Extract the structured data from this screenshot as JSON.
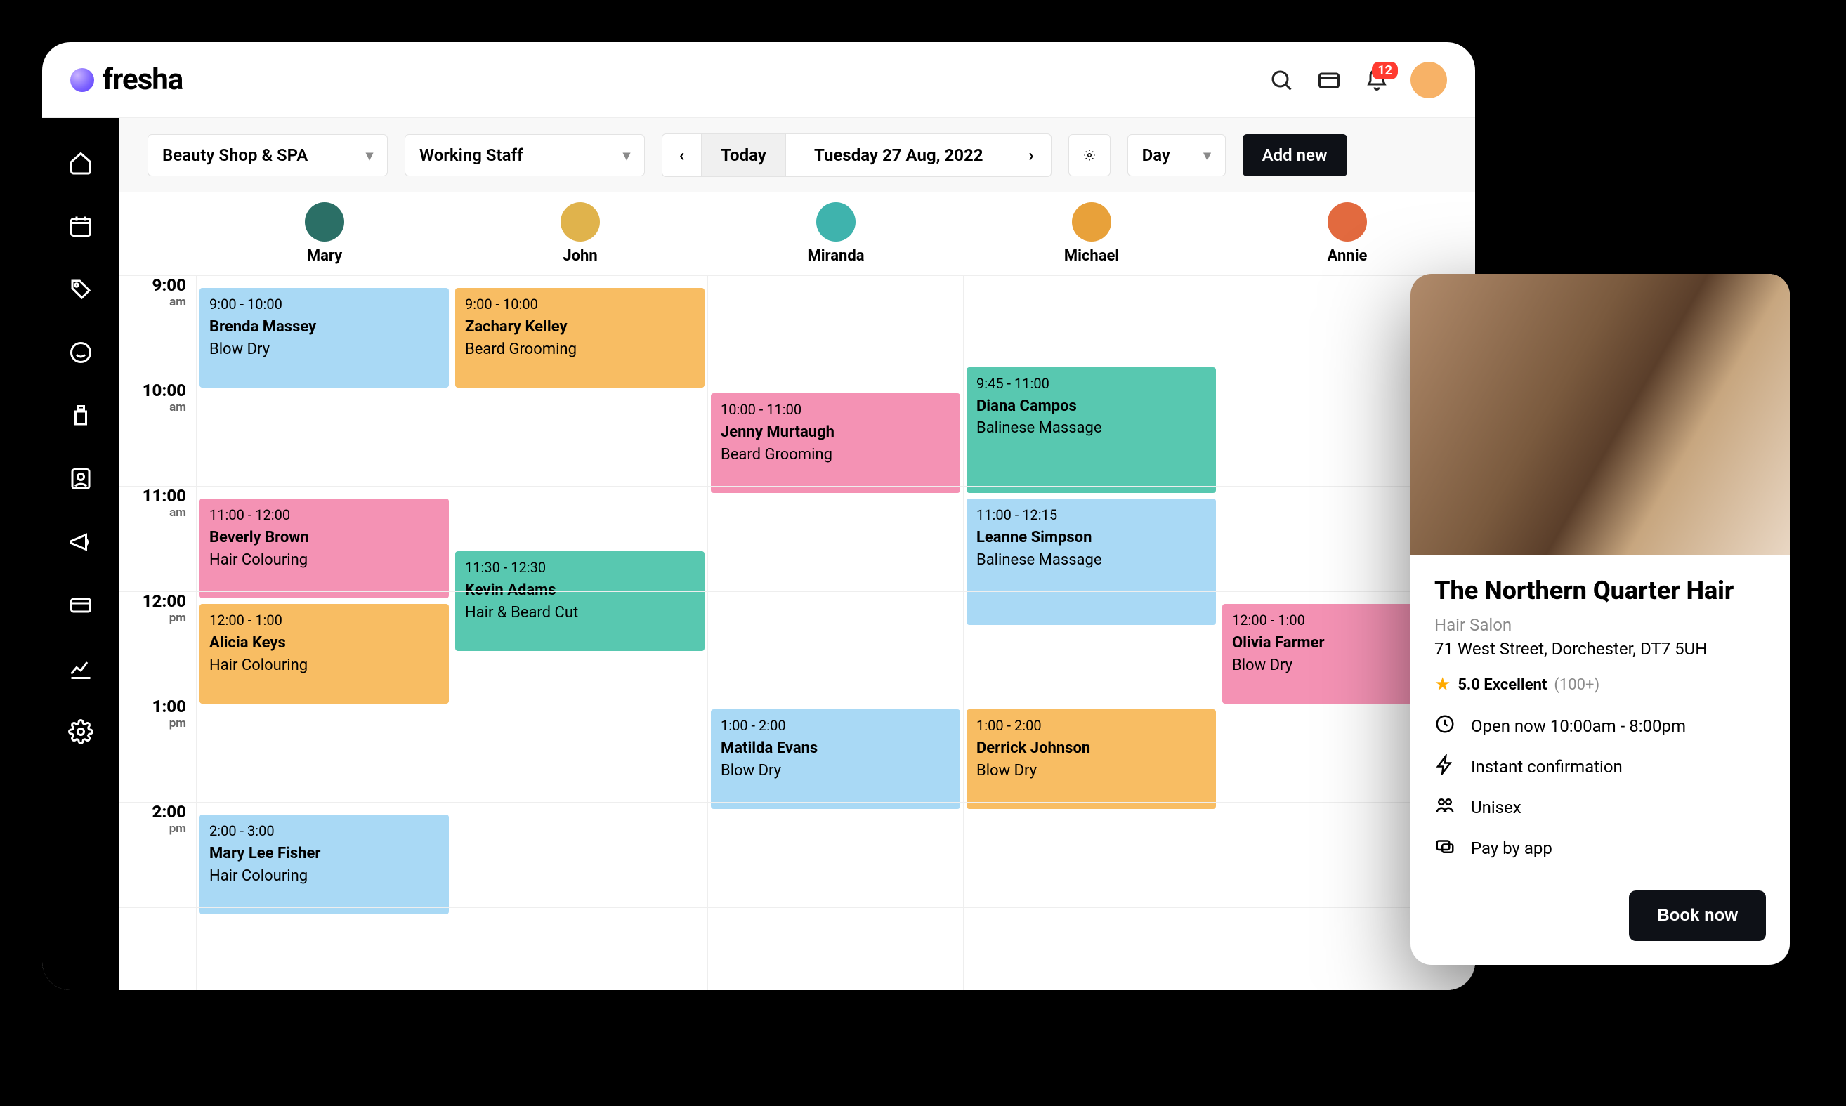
{
  "brand": {
    "name": "fresha"
  },
  "header": {
    "notification_count": "12"
  },
  "toolbar": {
    "location": "Beauty Shop & SPA",
    "staff_filter": "Working Staff",
    "today_label": "Today",
    "date_label": "Tuesday 27 Aug, 2022",
    "view_label": "Day",
    "add_label": "Add new"
  },
  "staff": [
    {
      "name": "Mary",
      "color": "#2b6f66"
    },
    {
      "name": "John",
      "color": "#e0b34c"
    },
    {
      "name": "Miranda",
      "color": "#3fb3ad"
    },
    {
      "name": "Michael",
      "color": "#e8a13a"
    },
    {
      "name": "Annie",
      "color": "#e26a3f"
    }
  ],
  "hours": [
    {
      "label": "9:00",
      "sub": "am"
    },
    {
      "label": "10:00",
      "sub": "am"
    },
    {
      "label": "11:00",
      "sub": "am"
    },
    {
      "label": "12:00",
      "sub": "pm"
    },
    {
      "label": "1:00",
      "sub": "pm"
    },
    {
      "label": "2:00",
      "sub": "pm"
    }
  ],
  "events": [
    {
      "col": 0,
      "start": 0.0,
      "end": 1.0,
      "time": "9:00 - 10:00",
      "name": "Brenda Massey",
      "service": "Blow Dry",
      "color": "blue"
    },
    {
      "col": 0,
      "start": 2.0,
      "end": 3.0,
      "time": "11:00 - 12:00",
      "name": "Beverly Brown",
      "service": "Hair Colouring",
      "color": "pink"
    },
    {
      "col": 0,
      "start": 3.0,
      "end": 4.0,
      "time": "12:00 - 1:00",
      "name": "Alicia Keys",
      "service": "Hair Colouring",
      "color": "orange"
    },
    {
      "col": 0,
      "start": 5.0,
      "end": 6.0,
      "time": "2:00 - 3:00",
      "name": "Mary Lee Fisher",
      "service": "Hair Colouring",
      "color": "blue"
    },
    {
      "col": 1,
      "start": 0.0,
      "end": 1.0,
      "time": "9:00 - 10:00",
      "name": "Zachary Kelley",
      "service": "Beard Grooming",
      "color": "orange"
    },
    {
      "col": 1,
      "start": 2.5,
      "end": 3.5,
      "time": "11:30 - 12:30",
      "name": "Kevin Adams",
      "service": "Hair & Beard Cut",
      "color": "teal"
    },
    {
      "col": 2,
      "start": 1.0,
      "end": 2.0,
      "time": "10:00 - 11:00",
      "name": "Jenny Murtaugh",
      "service": "Beard Grooming",
      "color": "pink"
    },
    {
      "col": 2,
      "start": 4.0,
      "end": 5.0,
      "time": "1:00 - 2:00",
      "name": "Matilda Evans",
      "service": "Blow Dry",
      "color": "blue"
    },
    {
      "col": 3,
      "start": 0.75,
      "end": 2.0,
      "time": "9:45 - 11:00",
      "name": "Diana Campos",
      "service": "Balinese Massage",
      "color": "teal"
    },
    {
      "col": 3,
      "start": 2.0,
      "end": 3.25,
      "time": "11:00 - 12:15",
      "name": "Leanne Simpson",
      "service": "Balinese Massage",
      "color": "blue"
    },
    {
      "col": 3,
      "start": 4.0,
      "end": 5.0,
      "time": "1:00 - 2:00",
      "name": "Derrick Johnson",
      "service": "Blow Dry",
      "color": "orange"
    },
    {
      "col": 4,
      "start": 3.0,
      "end": 4.0,
      "time": "12:00 - 1:00",
      "name": "Olivia Farmer",
      "service": "Blow Dry",
      "color": "pink"
    }
  ],
  "promo": {
    "title": "The Northern Quarter Hair",
    "category": "Hair Salon",
    "address": "71 West Street, Dorchester, DT7 5UH",
    "rating_score": "5.0 Excellent",
    "rating_count": "(100+)",
    "features": [
      "Open now 10:00am - 8:00pm",
      "Instant confirmation",
      "Unisex",
      "Pay by app"
    ],
    "cta": "Book now"
  }
}
